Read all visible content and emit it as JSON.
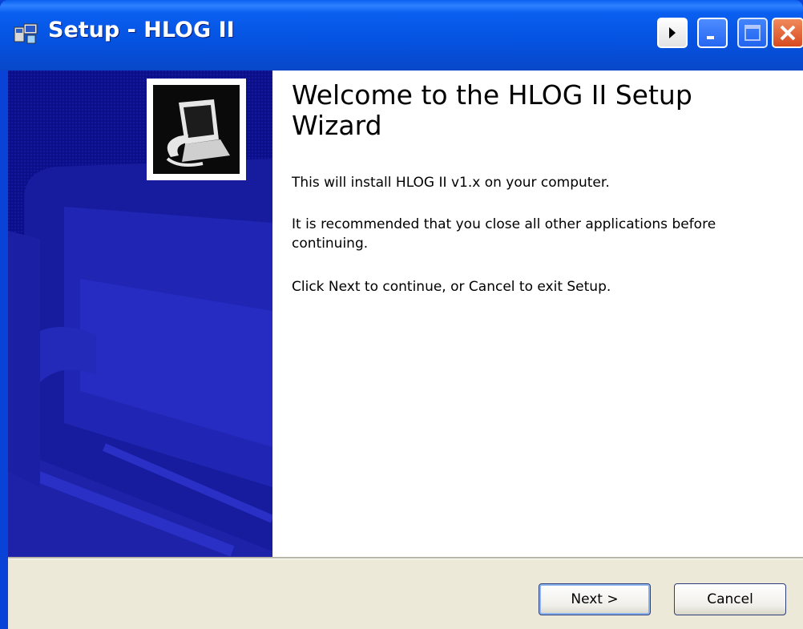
{
  "window": {
    "title": "Setup - HLOG II"
  },
  "content": {
    "heading": "Welcome to the HLOG II Setup Wizard",
    "paragraphs": [
      "This will install HLOG II v1.x on your computer.",
      "It is recommended that you close all other applications before continuing.",
      "Click Next to continue, or Cancel to exit Setup."
    ]
  },
  "buttons": {
    "next_label": "Next >",
    "cancel_label": "Cancel"
  },
  "colors": {
    "titlebar": "#0a5ff0",
    "banner": "#0c0f8a",
    "dialog_face": "#ece9d8",
    "close_button": "#d84a20"
  },
  "icons": {
    "title": "setup-app-icon",
    "banner": "computer-install-icon",
    "title_buttons": [
      "arrow-right-icon",
      "minimize-icon",
      "maximize-icon",
      "close-icon"
    ]
  }
}
